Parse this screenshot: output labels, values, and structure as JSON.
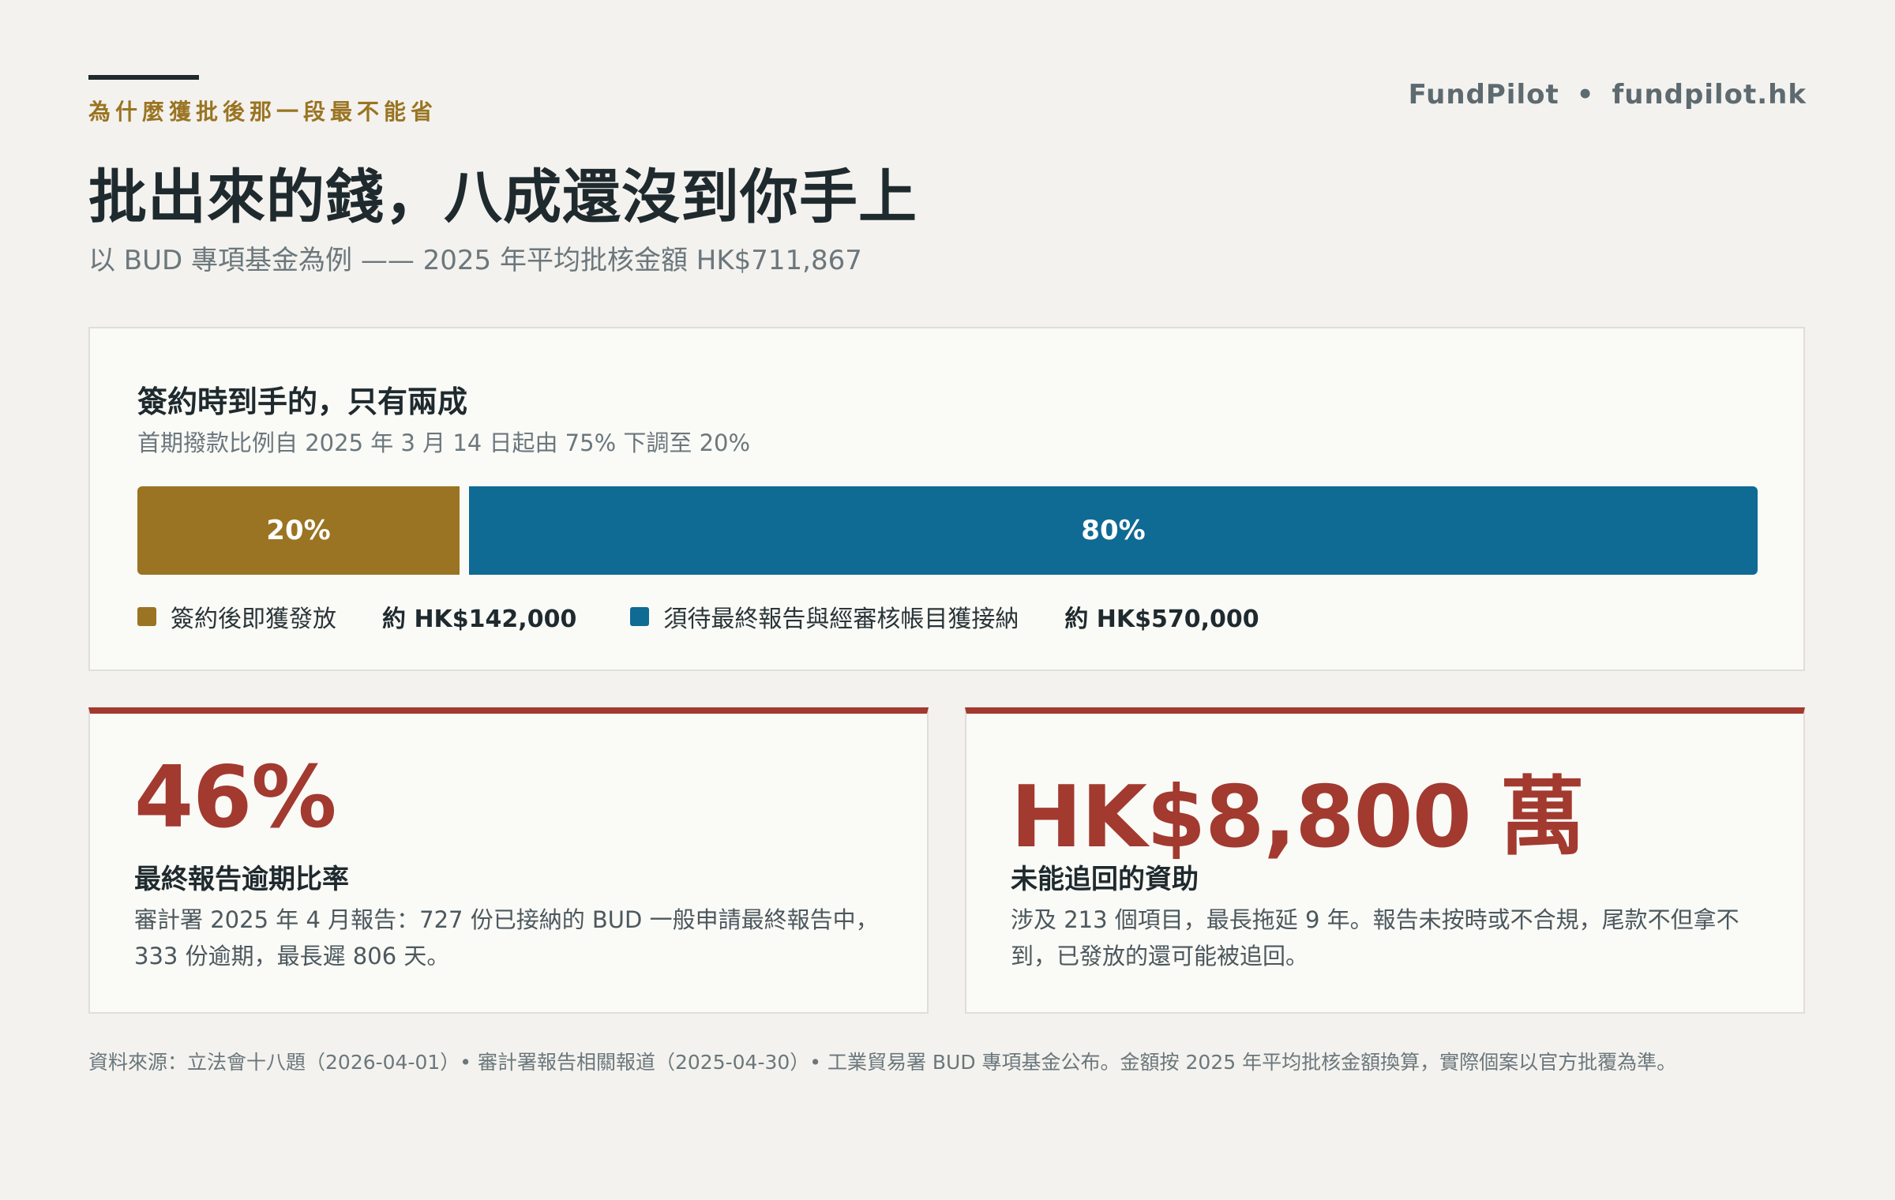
{
  "header": {
    "eyebrow": "為什麼獲批後那一段最不能省",
    "brand_name": "FundPilot",
    "brand_separator": "•",
    "brand_url": "fundpilot.hk",
    "title": "批出來的錢，八成還沒到你手上",
    "subtitle": "以 BUD 專項基金為例 —— 2025 年平均批核金額 HK$711,867"
  },
  "split_panel": {
    "heading": "簽約時到手的，只有兩成",
    "note": "首期撥款比例自 2025 年 3 月 14 日起由 75% 下調至 20%"
  },
  "chart_data": {
    "type": "bar",
    "orientation": "horizontal-stacked",
    "total_label": "2025 年平均批核金額 HK$711,867",
    "series": [
      {
        "name": "簽約後即獲發放",
        "value": 20,
        "label": "20%",
        "amount_label": "約 HK$142,000",
        "color": "#9a7422"
      },
      {
        "name": "須待最終報告與經審核帳目獲接納",
        "value": 80,
        "label": "80%",
        "amount_label": "約 HK$570,000",
        "color": "#0f6a94"
      }
    ],
    "unit": "%",
    "range": [
      0,
      100
    ],
    "legend_position": "bottom-left"
  },
  "stats": [
    {
      "value": "46%",
      "label": "最終報告逾期比率",
      "description": "審計署 2025 年 4 月報告：727 份已接納的 BUD 一般申請最終報告中，333 份逾期，最長遲 806 天。"
    },
    {
      "value": "HK$8,800 萬",
      "label": "未能追回的資助",
      "description": "涉及 213 個項目，最長拖延 9 年。報告未按時或不合規，尾款不但拿不到，已發放的還可能被追回。"
    }
  ],
  "colors": {
    "background": "#f3f2ee",
    "panel": "#fafaf7",
    "accent_gold": "#9a7422",
    "accent_blue": "#0f6a94",
    "accent_red": "#a23a2f",
    "ink": "#1f2a2e"
  },
  "footer": {
    "source": "資料來源：立法會十八題（2026-04-01）• 審計署報告相關報道（2025-04-30）• 工業貿易署 BUD 專項基金公布。金額按 2025 年平均批核金額換算，實際個案以官方批覆為準。"
  }
}
